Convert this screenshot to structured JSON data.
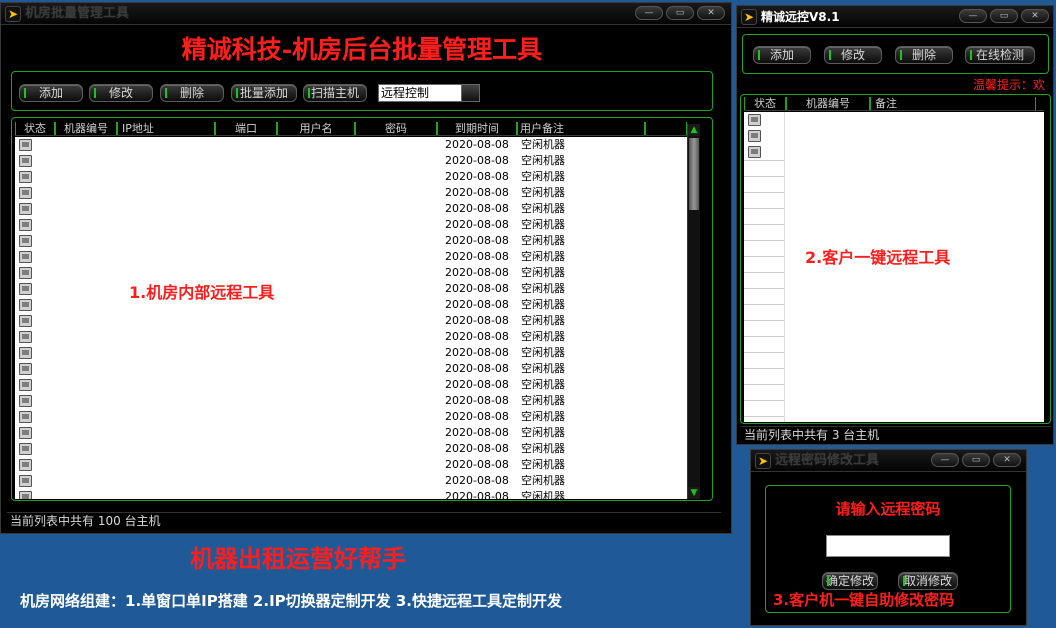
{
  "main_window": {
    "title": "机房批量管理工具",
    "banner": "精诚科技-机房后台批量管理工具",
    "toolbar": {
      "add": "添加",
      "edit": "修改",
      "delete": "删除",
      "batch_add": "批量添加",
      "scan_host": "扫描主机",
      "remote_select_value": "远程控制"
    },
    "columns": [
      "状态",
      "机器编号",
      "IP地址",
      "端口",
      "用户名",
      "密码",
      "到期时间",
      "用户备注"
    ],
    "row_date": "2020-08-08",
    "row_note": "空闲机器",
    "annotation": "1.机房内部远程工具",
    "status": "当前列表中共有 100 台主机"
  },
  "remote_window": {
    "title": "精诚远控V8.1",
    "buttons": {
      "add": "添加",
      "edit": "修改",
      "delete": "删除",
      "online_check": "在线检测"
    },
    "hint": "温馨提示：欢",
    "columns": [
      "状态",
      "机器编号",
      "备注"
    ],
    "annotation": "2.客户一键远程工具",
    "status": "当前列表中共有 3 台主机"
  },
  "password_window": {
    "title": "远程密码修改工具",
    "prompt": "请输入远程密码",
    "input_value": "",
    "confirm": "确定修改",
    "cancel": "取消修改",
    "annotation": "3.客户机一键自助修改密码"
  },
  "promo": {
    "headline": "机器出租运营好帮手",
    "subline": "机房网络组建：1.单窗口单IP搭建 2.IP切换器定制开发 3.快捷远程工具定制开发"
  },
  "colors": {
    "accent_green": "#1fa31f",
    "annotation_red": "#ff1e1e",
    "desktop_blue": "#1f5a96"
  }
}
